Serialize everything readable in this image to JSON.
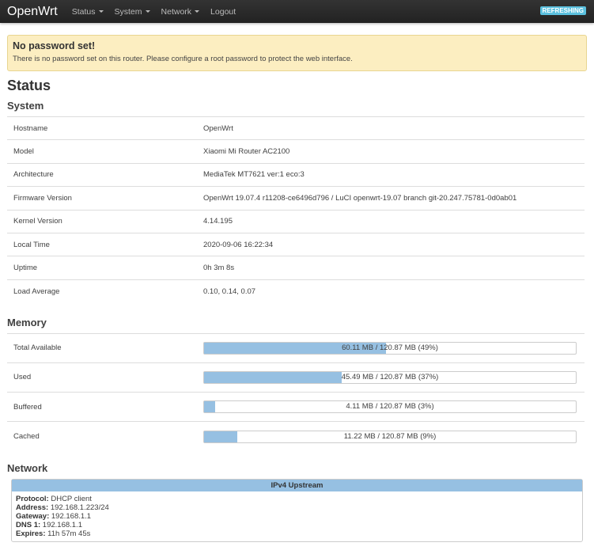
{
  "nav": {
    "brand": "OpenWrt",
    "menus": [
      "Status",
      "System",
      "Network"
    ],
    "logout": "Logout",
    "refreshing": "REFRESHING"
  },
  "alert": {
    "title": "No password set!",
    "text": "There is no password set on this router. Please configure a root password to protect the web interface."
  },
  "page_title": "Status",
  "system": {
    "title": "System",
    "rows": [
      [
        "Hostname",
        "OpenWrt"
      ],
      [
        "Model",
        "Xiaomi Mi Router AC2100"
      ],
      [
        "Architecture",
        "MediaTek MT7621 ver:1 eco:3"
      ],
      [
        "Firmware Version",
        "OpenWrt 19.07.4 r11208-ce6496d796 / LuCI openwrt-19.07 branch git-20.247.75781-0d0ab01"
      ],
      [
        "Kernel Version",
        "4.14.195"
      ],
      [
        "Local Time",
        "2020-09-06 16:22:34"
      ],
      [
        "Uptime",
        "0h 3m 8s"
      ],
      [
        "Load Average",
        "0.10, 0.14, 0.07"
      ]
    ]
  },
  "memory": {
    "title": "Memory",
    "rows": [
      {
        "label": "Total Available",
        "text": "60.11 MB / 120.87 MB (49%)",
        "percent": 49
      },
      {
        "label": "Used",
        "text": "45.49 MB / 120.87 MB (37%)",
        "percent": 37
      },
      {
        "label": "Buffered",
        "text": "4.11 MB / 120.87 MB (3%)",
        "percent": 3
      },
      {
        "label": "Cached",
        "text": "11.22 MB / 120.87 MB (9%)",
        "percent": 9
      }
    ]
  },
  "network": {
    "title": "Network",
    "upstream_title": "IPv4 Upstream",
    "fields": [
      [
        "Protocol:",
        "DHCP client"
      ],
      [
        "Address:",
        "192.168.1.223/24"
      ],
      [
        "Gateway:",
        "192.168.1.1"
      ],
      [
        "DNS 1:",
        "192.168.1.1"
      ],
      [
        "Expires:",
        "11h 57m 45s"
      ]
    ]
  }
}
